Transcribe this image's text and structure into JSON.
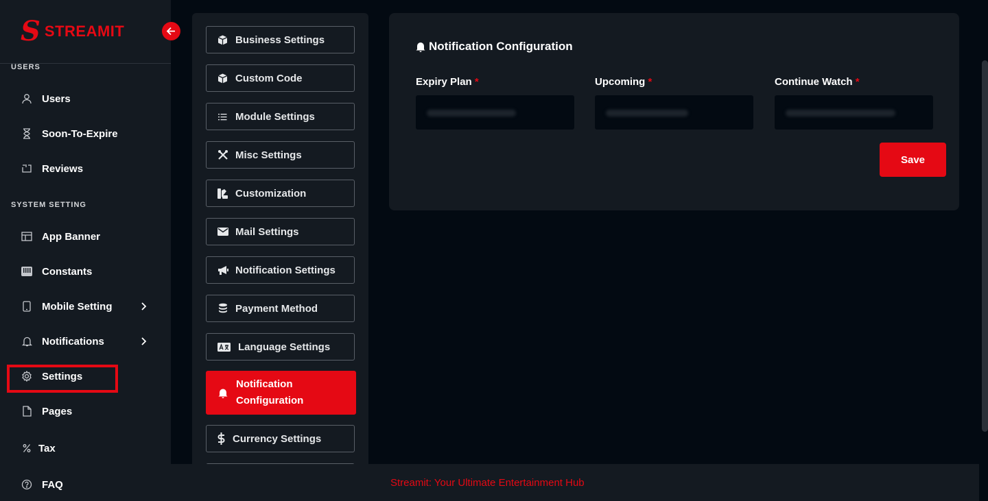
{
  "brand": {
    "letter": "S",
    "name": "STREAMIT"
  },
  "sidebar": {
    "sections": [
      {
        "label": "USERS"
      },
      {
        "label": "SYSTEM SETTING"
      }
    ],
    "items": [
      {
        "label": "Users",
        "icon": "user-icon"
      },
      {
        "label": "Soon-To-Expire",
        "icon": "hourglass-icon"
      },
      {
        "label": "Reviews",
        "icon": "review-icon"
      },
      {
        "label": "App Banner",
        "icon": "banner-icon"
      },
      {
        "label": "Constants",
        "icon": "constants-icon"
      },
      {
        "label": "Mobile Setting",
        "icon": "mobile-icon"
      },
      {
        "label": "Notifications",
        "icon": "bell-icon"
      },
      {
        "label": "Settings",
        "icon": "gear-icon"
      },
      {
        "label": "Pages",
        "icon": "page-icon"
      },
      {
        "label": "Tax",
        "icon": "percent-icon"
      },
      {
        "label": "FAQ",
        "icon": "question-icon"
      }
    ]
  },
  "settings_menu": {
    "items": [
      {
        "label": "Business Settings",
        "icon": "cube-icon"
      },
      {
        "label": "Custom Code",
        "icon": "cube-icon"
      },
      {
        "label": "Module Settings",
        "icon": "list-icon"
      },
      {
        "label": "Misc Settings",
        "icon": "tools-icon"
      },
      {
        "label": "Customization",
        "icon": "palette-icon"
      },
      {
        "label": "Mail Settings",
        "icon": "envelope-icon"
      },
      {
        "label": "Notification Settings",
        "icon": "megaphone-icon"
      },
      {
        "label": "Payment Method",
        "icon": "coins-icon"
      },
      {
        "label": "Language Settings",
        "icon": "language-icon"
      },
      {
        "label_line1": "Notification",
        "label_line2": "Configuration",
        "icon": "bell-icon",
        "active": true
      },
      {
        "label": "Currency Settings",
        "icon": "dollar-icon"
      }
    ]
  },
  "card": {
    "title": "Notification Configuration",
    "fields": [
      {
        "label": "Expiry Plan",
        "required": "*"
      },
      {
        "label": "Upcoming",
        "required": "*"
      },
      {
        "label": "Continue Watch",
        "required": "*"
      }
    ],
    "save_label": "Save"
  },
  "footer": {
    "text": "Streamit: Your Ultimate Entertainment Hub"
  },
  "colors": {
    "accent": "#e50914",
    "panel": "#141a21",
    "background": "#030a12"
  }
}
